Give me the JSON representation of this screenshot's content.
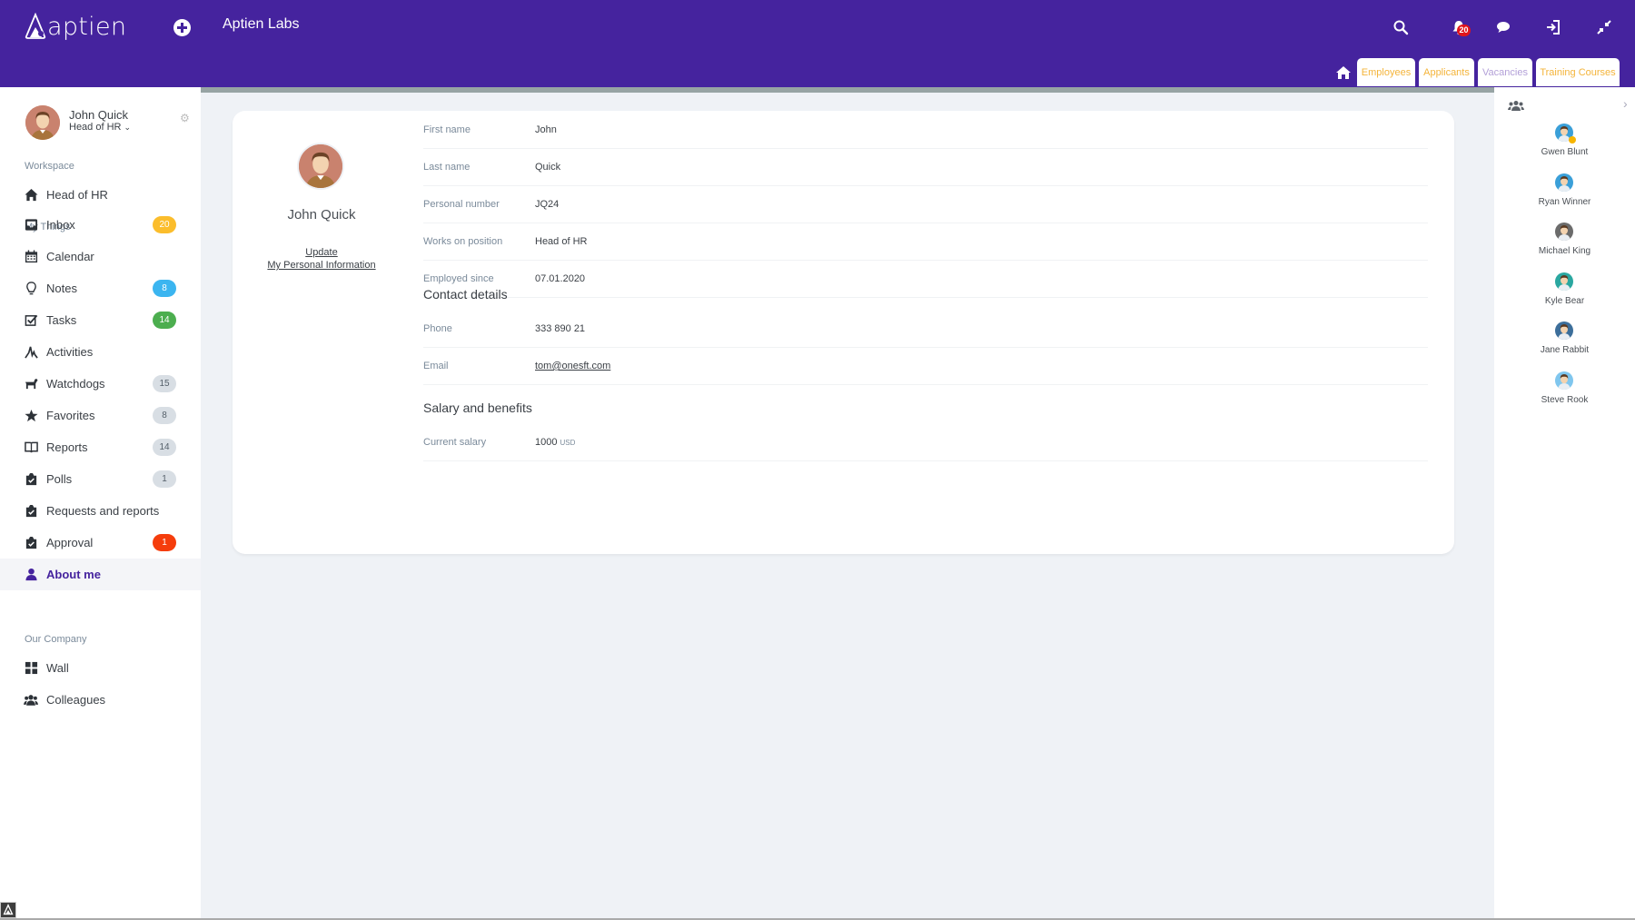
{
  "header": {
    "logo_text": "aptien",
    "org_name": "Aptien Labs",
    "notifications_count": "20",
    "icons": [
      "plus-circle-icon",
      "search-icon",
      "bell-icon",
      "chat-icon",
      "logout-icon",
      "compress-icon"
    ],
    "tabs": [
      {
        "label": "Employees",
        "color": "#f4b43a"
      },
      {
        "label": "Applicants",
        "color": "#f4b43a"
      },
      {
        "label": "Vacancies",
        "color": "#b3a0d8"
      },
      {
        "label": "Training Courses",
        "color": "#f4b43a"
      }
    ]
  },
  "sidebar": {
    "user": {
      "name": "John Quick",
      "role": "Head of HR"
    },
    "sections": {
      "workspace": "Workspace",
      "my_things": "My Things",
      "our_company": "Our Company"
    },
    "workspace_item": {
      "label": "Head of HR",
      "icon": "home-icon"
    },
    "items": [
      {
        "label": "Inbox",
        "icon": "inbox-icon",
        "badge": "20",
        "badge_bg": "#fbbd2c",
        "badge_color": "#ffffff"
      },
      {
        "label": "Calendar",
        "icon": "calendar-icon"
      },
      {
        "label": "Notes",
        "icon": "lightbulb-icon",
        "badge": "8",
        "badge_bg": "#3bb5f0",
        "badge_color": "#ffffff"
      },
      {
        "label": "Tasks",
        "icon": "checkbox-icon",
        "badge": "14",
        "badge_bg": "#4cae4f",
        "badge_color": "#ffffff"
      },
      {
        "label": "Activities",
        "icon": "activity-icon"
      },
      {
        "label": "Watchdogs",
        "icon": "dog-icon",
        "badge": "15",
        "badge_bg": "#d8dee4",
        "badge_color": "#55606a"
      },
      {
        "label": "Favorites",
        "icon": "star-icon",
        "badge": "8",
        "badge_bg": "#d8dee4",
        "badge_color": "#55606a"
      },
      {
        "label": "Reports",
        "icon": "book-icon",
        "badge": "14",
        "badge_bg": "#d8dee4",
        "badge_color": "#55606a"
      },
      {
        "label": "Polls",
        "icon": "clipboard-check-icon",
        "badge": "1",
        "badge_bg": "#d8dee4",
        "badge_color": "#55606a"
      },
      {
        "label": "Requests and reports",
        "icon": "clipboard-check-icon"
      },
      {
        "label": "Approval",
        "icon": "clipboard-check-icon",
        "badge": "1",
        "badge_bg": "#f53d0c",
        "badge_color": "#ffffff"
      },
      {
        "label": "About me",
        "icon": "user-icon",
        "active": true
      }
    ],
    "company_items": [
      {
        "label": "Wall",
        "icon": "grid-icon"
      },
      {
        "label": "Colleagues",
        "icon": "users-icon"
      }
    ]
  },
  "profile": {
    "name": "John Quick",
    "update_link_line1": "Update",
    "update_link_line2": "My Personal Information",
    "fields": [
      {
        "label": "First name",
        "value": "John"
      },
      {
        "label": "Last name",
        "value": "Quick"
      },
      {
        "label": "Personal number",
        "value": "JQ24"
      },
      {
        "label": "Works on position",
        "value": "Head of HR"
      },
      {
        "label": "Employed since",
        "value": "07.01.2020"
      }
    ],
    "contact_title": "Contact details",
    "contact": [
      {
        "label": "Phone",
        "value": "333 890 21"
      },
      {
        "label": "Email",
        "value": "tom@onesft.com"
      }
    ],
    "salary_title": "Salary and benefits",
    "salary": {
      "label": "Current salary",
      "value": "1000",
      "unit": "USD"
    }
  },
  "colleagues": [
    {
      "name": "Gwen Blunt",
      "online": true,
      "bg": "#3a9fd8"
    },
    {
      "name": "Ryan Winner",
      "bg": "#3a9fd8"
    },
    {
      "name": "Michael King",
      "bg": "#6b6b6b"
    },
    {
      "name": "Kyle Bear",
      "bg": "#2aa7a0"
    },
    {
      "name": "Jane Rabbit",
      "bg": "#3c6e9a"
    },
    {
      "name": "Steve Rook",
      "bg": "#7fc6ee"
    }
  ]
}
